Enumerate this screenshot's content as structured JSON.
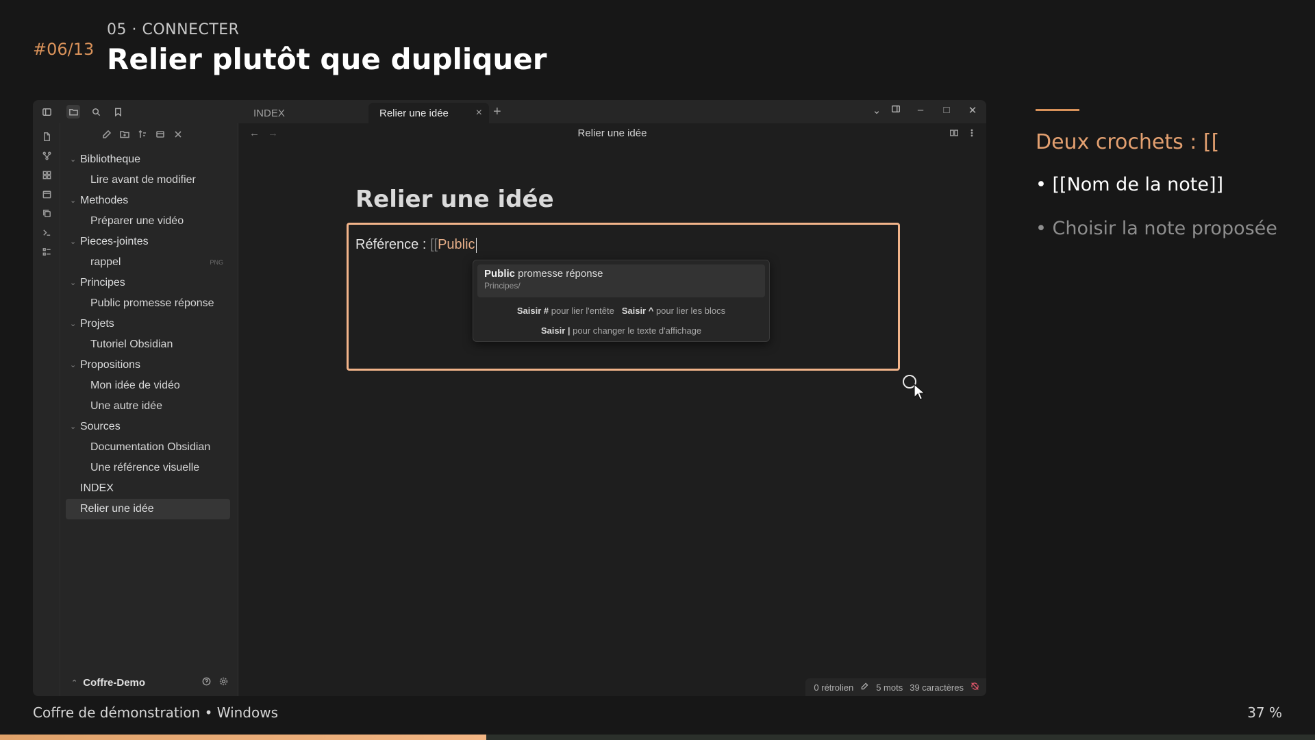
{
  "slide": {
    "number": "#06/13",
    "kicker": "05 · CONNECTER",
    "title": "Relier plutôt que dupliquer",
    "accent_color": "#d9925a"
  },
  "app": {
    "tabs": [
      {
        "label": "INDEX",
        "active": false
      },
      {
        "label": "Relier une idée",
        "active": true
      }
    ],
    "tab_close": "×",
    "tab_add": "+",
    "ribbon_icons": [
      "file-icon",
      "graph-icon",
      "grid-icon",
      "calendar-icon",
      "copy-icon",
      "terminal-icon",
      "list-icon"
    ],
    "sidebar": {
      "tree": [
        {
          "type": "folder",
          "label": "Bibliotheque"
        },
        {
          "type": "file",
          "label": "Lire avant de modifier"
        },
        {
          "type": "folder",
          "label": "Methodes"
        },
        {
          "type": "file",
          "label": "Préparer une vidéo"
        },
        {
          "type": "folder",
          "label": "Pieces-jointes"
        },
        {
          "type": "file",
          "label": "rappel",
          "badge": "PNG"
        },
        {
          "type": "folder",
          "label": "Principes"
        },
        {
          "type": "file",
          "label": "Public promesse réponse"
        },
        {
          "type": "folder",
          "label": "Projets"
        },
        {
          "type": "file",
          "label": "Tutoriel Obsidian"
        },
        {
          "type": "folder",
          "label": "Propositions"
        },
        {
          "type": "file",
          "label": "Mon idée de vidéo"
        },
        {
          "type": "file",
          "label": "Une autre idée"
        },
        {
          "type": "folder",
          "label": "Sources"
        },
        {
          "type": "file",
          "label": "Documentation Obsidian"
        },
        {
          "type": "file",
          "label": "Une référence visuelle"
        },
        {
          "type": "root",
          "label": "INDEX"
        },
        {
          "type": "root",
          "label": "Relier une idée",
          "selected": true
        }
      ],
      "vault_name": "Coffre-Demo"
    },
    "main": {
      "view_title": "Relier une idée",
      "heading": "Relier une idée",
      "ref_label": "Référence : ",
      "ref_brackets": "[[",
      "ref_typed": "Public",
      "suggestion": {
        "title_bold": "Public",
        "title_rest": " promesse réponse",
        "path": "Principes/",
        "hint1_k1": "Saisir #",
        "hint1_t1": " pour lier l'entête   ",
        "hint1_k2": "Saisir ^",
        "hint1_t2": " pour lier les blocs",
        "hint2_k": "Saisir |",
        "hint2_t": " pour changer le texte d'affichage"
      },
      "status": {
        "backlinks": "0 rétrolien",
        "words": "5 mots",
        "chars": "39 caractères"
      }
    }
  },
  "panel": {
    "title": "Deux crochets : [[",
    "bullets": [
      "• [[Nom de la note]]",
      "• Choisir la note proposée"
    ]
  },
  "footer": {
    "left": "Coffre de démonstration • Windows",
    "right": "37 %",
    "progress": 0.37
  }
}
